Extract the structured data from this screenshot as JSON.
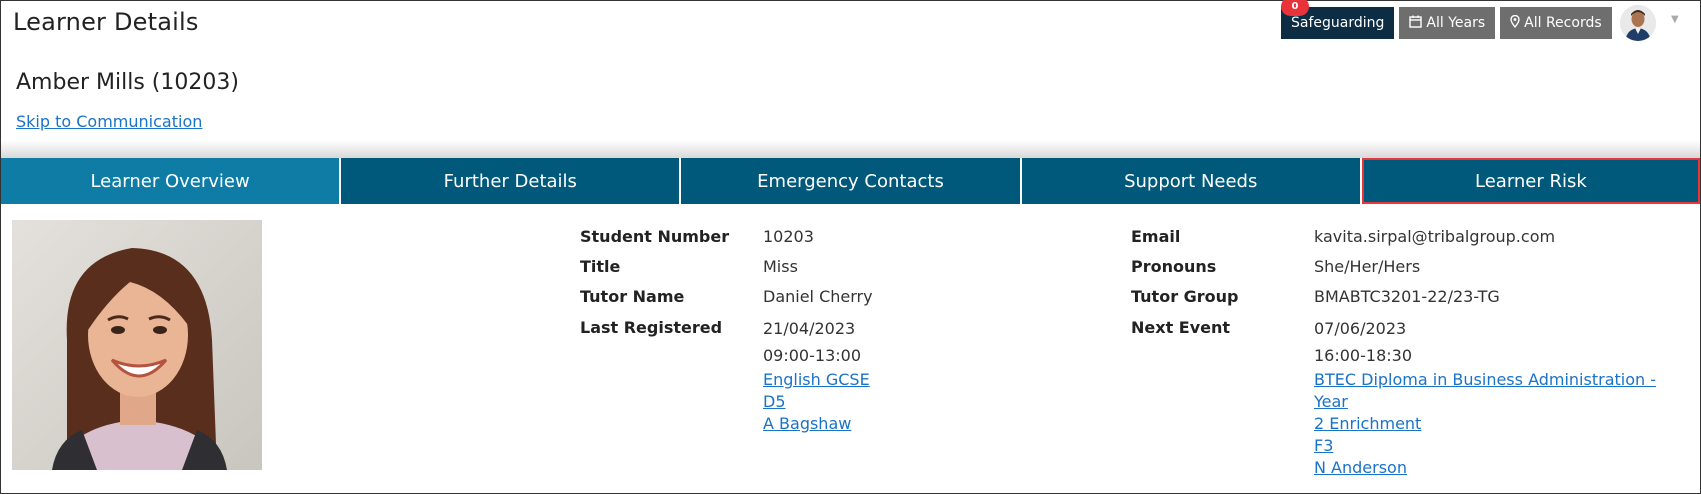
{
  "header": {
    "title": "Learner Details",
    "safeguarding_label": "Safeguarding",
    "safeguarding_count": "0",
    "all_years_label": "All Years",
    "all_records_label": "All Records"
  },
  "learner": {
    "name": "Amber Mills (10203)",
    "skip_link": "Skip to Communication"
  },
  "tabs": [
    {
      "label": "Learner Overview",
      "active": true
    },
    {
      "label": "Further Details"
    },
    {
      "label": "Emergency Contacts"
    },
    {
      "label": "Support Needs"
    },
    {
      "label": "Learner Risk"
    }
  ],
  "left": {
    "student_number_label": "Student Number",
    "student_number": "10203",
    "title_label": "Title",
    "title": "Miss",
    "tutor_name_label": "Tutor Name",
    "tutor_name": "Daniel Cherry",
    "last_registered_label": "Last Registered",
    "last_registered_date": "21/04/2023",
    "last_registered_time": "09:00-13:00",
    "last_registered_course": "English GCSE",
    "last_registered_room": "D5",
    "last_registered_staff": "A Bagshaw"
  },
  "right": {
    "email_label": "Email",
    "email": "kavita.sirpal@tribalgroup.com",
    "pronouns_label": "Pronouns",
    "pronouns": "She/Her/Hers",
    "tutor_group_label": "Tutor Group",
    "tutor_group": "BMABTC3201-22/23-TG",
    "next_event_label": "Next Event",
    "next_event_date": "07/06/2023",
    "next_event_time": "16:00-18:30",
    "next_event_course_line1": "BTEC Diploma in Business Administration - Year",
    "next_event_course_line2": "2 Enrichment",
    "next_event_room": "F3",
    "next_event_staff": "N Anderson"
  },
  "colors": {
    "tab_bg": "#00587a",
    "tab_active_bg": "#0f7ca6",
    "link": "#1a73c8",
    "safeguarding_bg": "#0d2d45",
    "badge": "#e8333b",
    "outline": "#e6373f"
  }
}
